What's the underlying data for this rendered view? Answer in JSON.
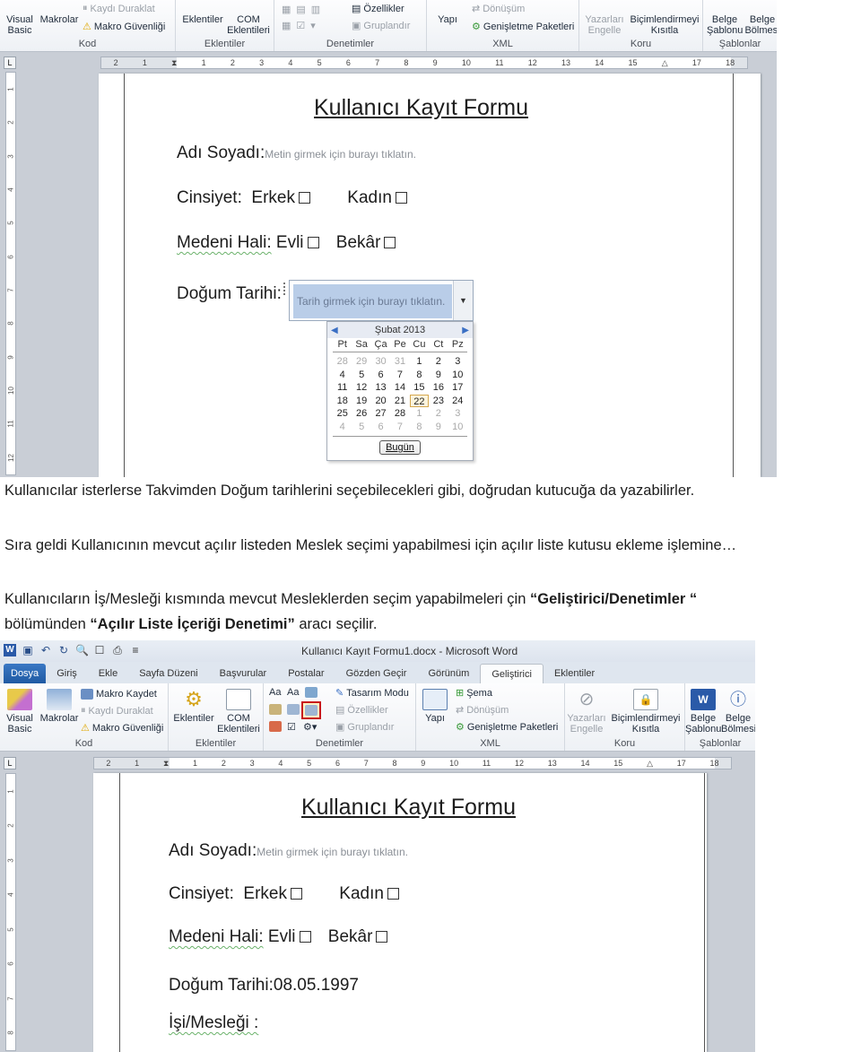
{
  "ribbon": {
    "groups": {
      "kod": "Kod",
      "eklentiler": "Eklentiler",
      "denetimler": "Denetimler",
      "xml": "XML",
      "koru": "Koru",
      "sablonlar": "Şablonlar"
    },
    "buttons": {
      "visual_basic": "Visual Basic",
      "makrolar": "Makrolar",
      "makro_kaydet": "Makro Kaydet",
      "kaydi_duraklat": "Kaydı Duraklat",
      "makro_guvenligi": "Makro Güvenliği",
      "eklentiler": "Eklentiler",
      "com_eklentileri": "COM Eklentileri",
      "tasarim_modu": "Tasarım Modu",
      "ozellikler": "Özellikler",
      "gruplandir": "Gruplandır",
      "yapi": "Yapı",
      "sema": "Şema",
      "donusum": "Dönüşüm",
      "genisletme_paketleri": "Genişletme Paketleri",
      "yazarlari_engelle": "Yazarları Engelle",
      "bicimlendirmeyi_kisitla": "Biçimlendirmeyi Kısıtla",
      "belge_sablonu": "Belge Şablonu",
      "belge_bolmesi": "Belge Bölmesi"
    }
  },
  "ruler": {
    "left_numbers": [
      "2",
      "1"
    ],
    "numbers": [
      "1",
      "2",
      "3",
      "4",
      "5",
      "6",
      "7",
      "8",
      "9",
      "10",
      "11",
      "12",
      "13",
      "14",
      "15",
      "17",
      "18"
    ],
    "vertical_numbers": [
      "1",
      "2",
      "3",
      "4",
      "5",
      "6",
      "7",
      "8",
      "9",
      "10",
      "11",
      "12"
    ]
  },
  "form": {
    "title": "Kullanıcı Kayıt Formu",
    "name_label": "Adı Soyadı:",
    "name_placeholder": "Metin girmek için burayı tıklatın.",
    "gender_label": "Cinsiyet:",
    "gender_male": "Erkek",
    "gender_female": "Kadın",
    "marital_label": "Medeni  Hali:",
    "marital_married": "Evli",
    "marital_single": "Bekâr",
    "birth_label": "Doğum Tarihi:",
    "birth_placeholder": "Tarih girmek için burayı tıklatın.",
    "birth_value": "08.05.1997",
    "job_label": "İşi/Mesleği :"
  },
  "calendar": {
    "month": "Şubat 2013",
    "weekdays": [
      "Pt",
      "Sa",
      "Ça",
      "Pe",
      "Cu",
      "Ct",
      "Pz"
    ],
    "days": [
      [
        "28",
        "29",
        "30",
        "31",
        "1",
        "2",
        "3"
      ],
      [
        "4",
        "5",
        "6",
        "7",
        "8",
        "9",
        "10"
      ],
      [
        "11",
        "12",
        "13",
        "14",
        "15",
        "16",
        "17"
      ],
      [
        "18",
        "19",
        "20",
        "21",
        "22",
        "23",
        "24"
      ],
      [
        "25",
        "26",
        "27",
        "28",
        "1",
        "2",
        "3"
      ],
      [
        "4",
        "5",
        "6",
        "7",
        "8",
        "9",
        "10"
      ]
    ],
    "selected": "22",
    "today_button": "Bugün"
  },
  "text": {
    "p1": "Kullanıcılar isterlerse Takvimden Doğum tarihlerini seçebilecekleri gibi, doğrudan kutucuğa da yazabilirler.",
    "p2": "Sıra geldi Kullanıcının mevcut açılır listeden Meslek seçimi yapabilmesi için açılır liste kutusu ekleme işlemine…",
    "p3_a": "Kullanıcıların İş/Mesleği kısmında mevcut Mesleklerden seçim yapabilmeleri çin ",
    "p3_b": "“Geliştirici/Denetimler “",
    "p4_a": "bölümünden ",
    "p4_b": "“Açılır Liste İçeriği Denetimi”",
    "p4_c": " aracı seçilir."
  },
  "window": {
    "title": "Kullanıcı Kayıt Formu1.docx - Microsoft Word",
    "tabs": [
      "Dosya",
      "Giriş",
      "Ekle",
      "Sayfa Düzeni",
      "Başvurular",
      "Postalar",
      "Gözden Geçir",
      "Görünüm",
      "Geliştirici",
      "Eklentiler"
    ],
    "active_tab": "Geliştirici"
  },
  "colors": {
    "highlight": "#c8191c",
    "file_tab": "#2a66b3",
    "placeholder_bg": "#b9cde8"
  }
}
